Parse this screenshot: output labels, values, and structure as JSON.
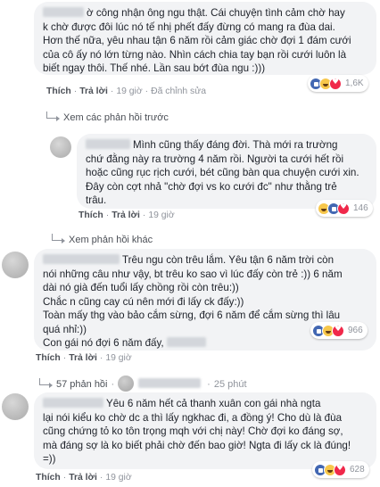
{
  "comments": [
    {
      "lines": [
        "ờ công nhận ông ngu thật. Cái chuyện tình cảm chờ hay",
        "k chờ được đôi lúc nó tế nhị phết đấy đừng có mang ra đùa dai.",
        "Hơn thế nữa, yêu nhau tận 6 năm rồi cảm giác chờ đợi 1 đám cưới",
        "của cô ấy nó lớn từng nào. Nhìn cách chia tay bạn rồi cưới luôn là",
        "biết ngay thôi. Thế nhé. Lần sau bớt đùa ngu :)))"
      ],
      "like": "Thích",
      "reply": "Trả lời",
      "time": "19 giờ",
      "extra": "Đã chỉnh sửa",
      "reactions": [
        "like",
        "haha",
        "love"
      ],
      "count": "1,6K"
    },
    {
      "lines": [
        "Mình cũng thấy đáng đời. Thà mới ra trường",
        "chứ đằng này ra trường 4 năm rồi. Người ta cưới hết rồi",
        "hoặc cũng rục rịch cưới, bét cũng bàn qua chuyện cưới xin.",
        "Đây còn cợt nhả \"chờ đợi vs ko cưới đc\" như thằng trẻ",
        "trâu."
      ],
      "like": "Thích",
      "reply": "Trả lời",
      "time": "19 giờ",
      "reactions": [
        "haha",
        "like",
        "love"
      ],
      "count": "146"
    },
    {
      "lines": [
        "Trêu ngu còn trêu lắm. Yêu tận 6 năm trời còn",
        "nói những câu như vậy, bt trêu ko sao vì lúc đấy còn trẻ :)) 6 năm",
        "dài nó già đến tuổi lấy chồng rồi còn trêu:))",
        "Chắc n cũng cay cú nên mới đi lấy ck đấy:))",
        "Toàn mấy thg vào bảo cắm sừng, đợi 6 năm để cắm sừng thì lâu",
        "quá nhỉ:))",
        "Con gái nó đợi 6 năm đấy,"
      ],
      "like": "Thích",
      "reply": "Trả lời",
      "time": "19 giờ",
      "reactions": [
        "like",
        "haha",
        "love"
      ],
      "count": "966"
    },
    {
      "lines": [
        "Yêu 6 năm hết cả thanh xuân con gái nhà ngta",
        "lại nói kiểu ko chờ dc a thì lấy ngkhac đi, a đồng ý! Cho dù là đùa",
        "cũng chứng tỏ ko tôn trọng mqh với chị này! Chờ đợi ko đáng sợ,",
        "mà đáng sợ là ko biết phải chờ đến bao giờ! Ngta đi lấy ck là đúng!",
        "=))"
      ],
      "like": "Thích",
      "reply": "Trả lời",
      "time": "19 giờ",
      "reactions": [
        "like",
        "haha",
        "love"
      ],
      "count": "628"
    }
  ],
  "links": {
    "prev_replies": "Xem các phản hồi trước",
    "other_replies": "Xem phản hồi khác",
    "reply_count": "57 phản hồi",
    "reply_time": "25 phút"
  },
  "colors": {
    "bubble": "#f2f3f5",
    "meta": "#90949c",
    "like": "#4267b2",
    "haha": "#f7c74b",
    "love": "#f0284a"
  }
}
